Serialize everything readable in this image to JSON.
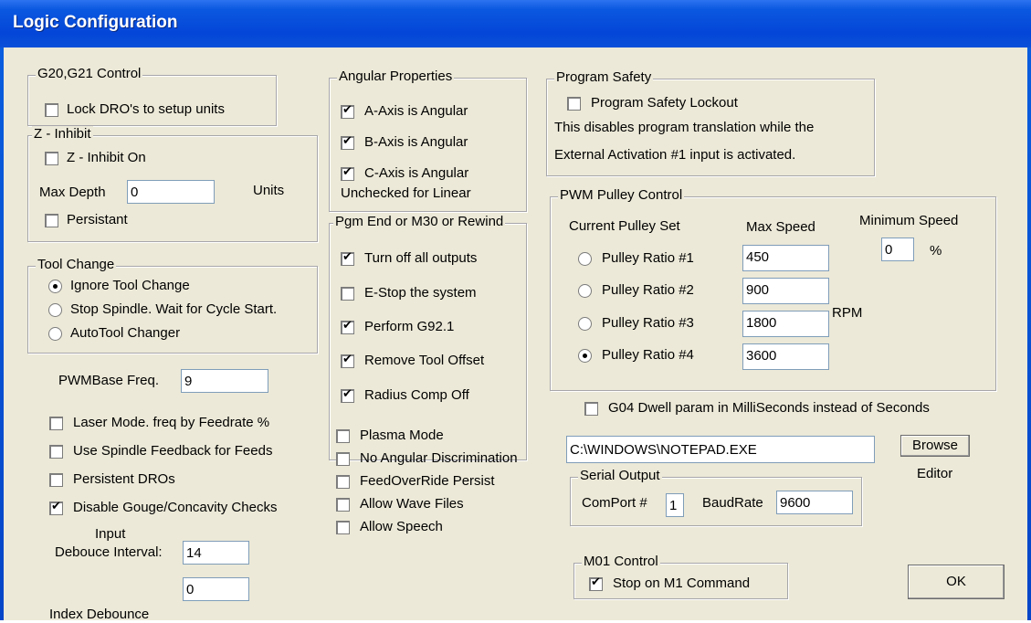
{
  "window": {
    "title": "Logic Configuration"
  },
  "g2021": {
    "label": "G20,G21 Control",
    "lock": {
      "label": "Lock DRO's to setup units",
      "checked": false
    }
  },
  "zinhibit": {
    "label": "Z - Inhibit",
    "on": {
      "label": "Z - Inhibit On",
      "checked": false
    },
    "max_depth_label": "Max Depth",
    "max_depth": "0",
    "units": "Units",
    "persist": {
      "label": "Persistant",
      "checked": false
    }
  },
  "toolchange": {
    "label": "Tool Change",
    "options": [
      "Ignore Tool Change",
      "Stop Spindle. Wait for Cycle Start.",
      "AutoTool Changer"
    ],
    "selected": 0
  },
  "pwmbase": {
    "label": "PWMBase Freq.",
    "value": "9"
  },
  "misc_left": [
    {
      "label": "Laser Mode. freq by Feedrate %",
      "checked": false
    },
    {
      "label": "Use Spindle Feedback for Feeds",
      "checked": false
    },
    {
      "label": "Persistent DROs",
      "checked": false
    },
    {
      "label": "Disable Gouge/Concavity Checks",
      "checked": true
    }
  ],
  "debounce": {
    "input_line1": "Input",
    "input_line2": "Debouce Interval:",
    "input_value": "14",
    "index_value": "0",
    "index_label": "Index Debounce"
  },
  "angular": {
    "label": "Angular Properties",
    "items": [
      {
        "label": "A-Axis is Angular",
        "checked": true
      },
      {
        "label": "B-Axis is Angular",
        "checked": true
      },
      {
        "label": "C-Axis is Angular",
        "checked": true
      }
    ],
    "note": "Unchecked for Linear"
  },
  "pgmend": {
    "label": "Pgm End or M30 or Rewind",
    "items": [
      {
        "label": "Turn off all outputs",
        "checked": true
      },
      {
        "label": "E-Stop the system",
        "checked": false
      },
      {
        "label": "Perform G92.1",
        "checked": true
      },
      {
        "label": "Remove Tool Offset",
        "checked": true
      },
      {
        "label": "Radius Comp Off",
        "checked": true
      }
    ]
  },
  "misc_mid": [
    {
      "label": "Plasma Mode",
      "checked": false
    },
    {
      "label": "No Angular Discrimination",
      "checked": false
    },
    {
      "label": "FeedOverRide Persist",
      "checked": false
    },
    {
      "label": "Allow Wave Files",
      "checked": false
    },
    {
      "label": "Allow Speech",
      "checked": false
    }
  ],
  "safety": {
    "label": "Program Safety",
    "lockout": {
      "label": "Program Safety Lockout",
      "checked": false
    },
    "desc1": "This disables program translation while the",
    "desc2": "External Activation #1 input is activated."
  },
  "pwm": {
    "label": "PWM Pulley Control",
    "current_label": "Current Pulley Set",
    "max_speed_label": "Max Speed",
    "min_speed_label": "Minimum Speed",
    "min_speed_value": "0",
    "percent": "%",
    "rpm": "RPM",
    "selected": 3,
    "pulleys": [
      {
        "label": "Pulley Ratio #1",
        "value": "450"
      },
      {
        "label": "Pulley Ratio #2",
        "value": "900"
      },
      {
        "label": "Pulley Ratio #3",
        "value": "1800"
      },
      {
        "label": "Pulley Ratio #4",
        "value": "3600"
      }
    ]
  },
  "g04": {
    "label": "G04 Dwell param in MilliSeconds instead of Seconds",
    "checked": false
  },
  "editor": {
    "path": "C:\\WINDOWS\\NOTEPAD.EXE",
    "browse_label": "Browse",
    "editor_label": "Editor"
  },
  "serial": {
    "label": "Serial Output",
    "comport_label": "ComPort #",
    "comport_value": "1",
    "baud_label": "BaudRate",
    "baud_value": "9600"
  },
  "m01": {
    "label": "M01 Control",
    "stop": {
      "label": "Stop on M1 Command",
      "checked": true
    }
  },
  "ok": {
    "label": "OK"
  }
}
